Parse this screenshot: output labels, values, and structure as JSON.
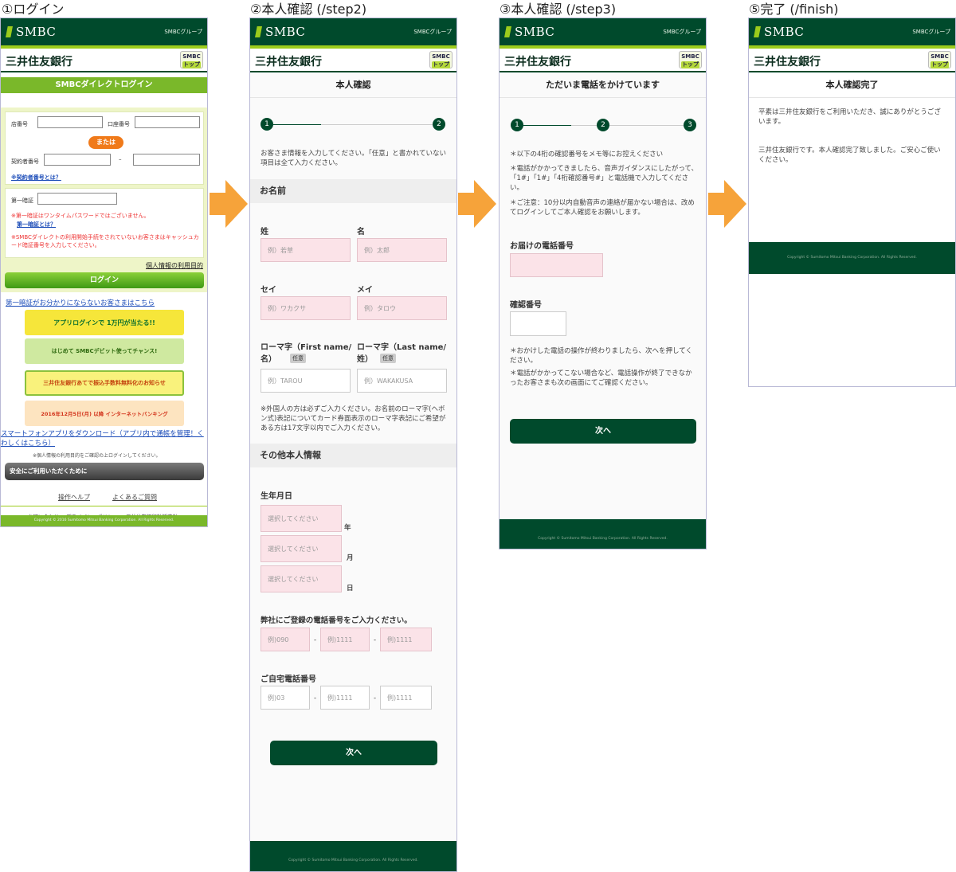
{
  "steps": {
    "s1": "①ログイン",
    "s2": "②本人確認 (/step2)",
    "s3": "③本人確認 (/step3)",
    "s5": "⑤完了 (/finish)"
  },
  "header": {
    "brand": "SMBC",
    "group": "SMBCグループ",
    "bank": "三井住友銀行",
    "top_line1": "SMBC",
    "top_line2": "トップ"
  },
  "login": {
    "title": "SMBCダイレクトログイン",
    "store_label": "店番号",
    "account_label": "口座番号",
    "or_label": "または",
    "contract_label": "契約者番号",
    "dash": "–",
    "contract_link": "※契約者番号とは？",
    "pin_label": "第一暗証",
    "warn1": "※第一暗証はワンタイムパスワードではございません。",
    "pin_link": "第一暗証とは？",
    "warn2": "※SMBCダイレクトの利用開始手続をされていないお客さまはキャッシュカード暗証番号を入力してください。",
    "privacy_link": "個人情報の利用目的",
    "login_button": "ログイン",
    "help_link": "第一暗証がお分かりにならないお客さまはこちら",
    "banner1": "アプリログインで 1万円が当たる!!",
    "banner2": "はじめて SMBCデビット使ってチャンス!",
    "banner3": "三井住友銀行あてで振込手数料無料化のお知らせ",
    "banner4": "2016年12月5日(月) 以降 インターネットバンキング",
    "app_link": "スマートフォンアプリをダウンロード（アプリ内で通帳を管理！くわしくはこちら）",
    "note": "※個人情報の利用目的をご確認の上ログインしてください。",
    "safety": "安全にご利用いただくために",
    "ops_help": "操作ヘルプ",
    "faq": "よくあるご質問",
    "contact": "お問い合わせ",
    "privacy_policy": "プライバシーポリシー",
    "bank_policy": "三井住友銀行勧誘方針",
    "copyright": "Copyright © 2016 Sumitomo Mitsui Banking Corporation. All Rights Reserved."
  },
  "step2": {
    "title": "本人確認",
    "step1": "1",
    "step2": "2",
    "intro": "お客さま情報を入力してください。「任意」と書かれていない項目は全て入力ください。",
    "name_section": "お名前",
    "sei_label": "姓",
    "mei_label": "名",
    "sei_ph": "例）若草",
    "mei_ph": "例）太郎",
    "seikana_label": "セイ",
    "meikana_label": "メイ",
    "seikana_ph": "例）ワカクサ",
    "meikana_ph": "例）タロウ",
    "roman_first_label": "ローマ字（First name/名）",
    "roman_last_label": "ローマ字（Last name/姓）",
    "optional": "任意",
    "roman_first_ph": "例）TAROU",
    "roman_last_ph": "例）WAKAKUSA",
    "foreign_note": "※外国人の方は必ずご入力ください。お名前のローマ字(ヘボン式)表記についてカード券面表示のローマ字表記にご希望がある方は17文字以内でご入力ください。",
    "other_section": "その他本人情報",
    "dob_label": "生年月日",
    "select_ph": "選択してください",
    "year": "年",
    "month": "月",
    "day": "日",
    "phone_label": "弊社にご登録の電話番号をご入力ください。",
    "phone_ph1": "例)090",
    "phone_ph2": "例)1111",
    "phone_ph3": "例)1111",
    "dash": "-",
    "home_label": "ご自宅電話番号",
    "home_ph1": "例)03",
    "home_ph2": "例)1111",
    "home_ph3": "例)1111",
    "next": "次へ",
    "copyright": "Copyright © Sumitomo Mitsui Banking Corporation. All Rights Reserved."
  },
  "step3": {
    "title": "ただいま電話をかけています",
    "step1": "1",
    "step2": "2",
    "step3": "3",
    "note1": "＊以下の4桁の確認番号をメモ等にお控えください",
    "note2": "＊電話がかかってきましたら、音声ガイダンスにしたがって、「1#」「1#」「4桁確認番号#」と電話機で入力してください。",
    "note3": "＊ご注意：10分以内自動音声の連絡が届かない場合は、改めてログインしてご本人確認をお願いします。",
    "phone_label": "お届けの電話番号",
    "code_label": "確認番号",
    "note4": "＊おかけした電話の操作が終わりましたら、次へを押してください。",
    "note5": "＊電話がかかってこない場合など、電話操作が終了できなかったお客さまも次の画面にてご確認ください。",
    "next": "次へ",
    "copyright": "Copyright © Sumitomo Mitsui Banking Corporation. All Rights Reserved."
  },
  "finish": {
    "title": "本人確認完了",
    "msg1": "平素は三井住友銀行をご利用いただき、誠にありがとうございます。",
    "msg2": "三井住友銀行です。本人確認完了致しました。ご安心ご使いください。",
    "copyright": "Copyright © Sumitomo Mitsui Banking Corporation. All Rights Reserved."
  }
}
